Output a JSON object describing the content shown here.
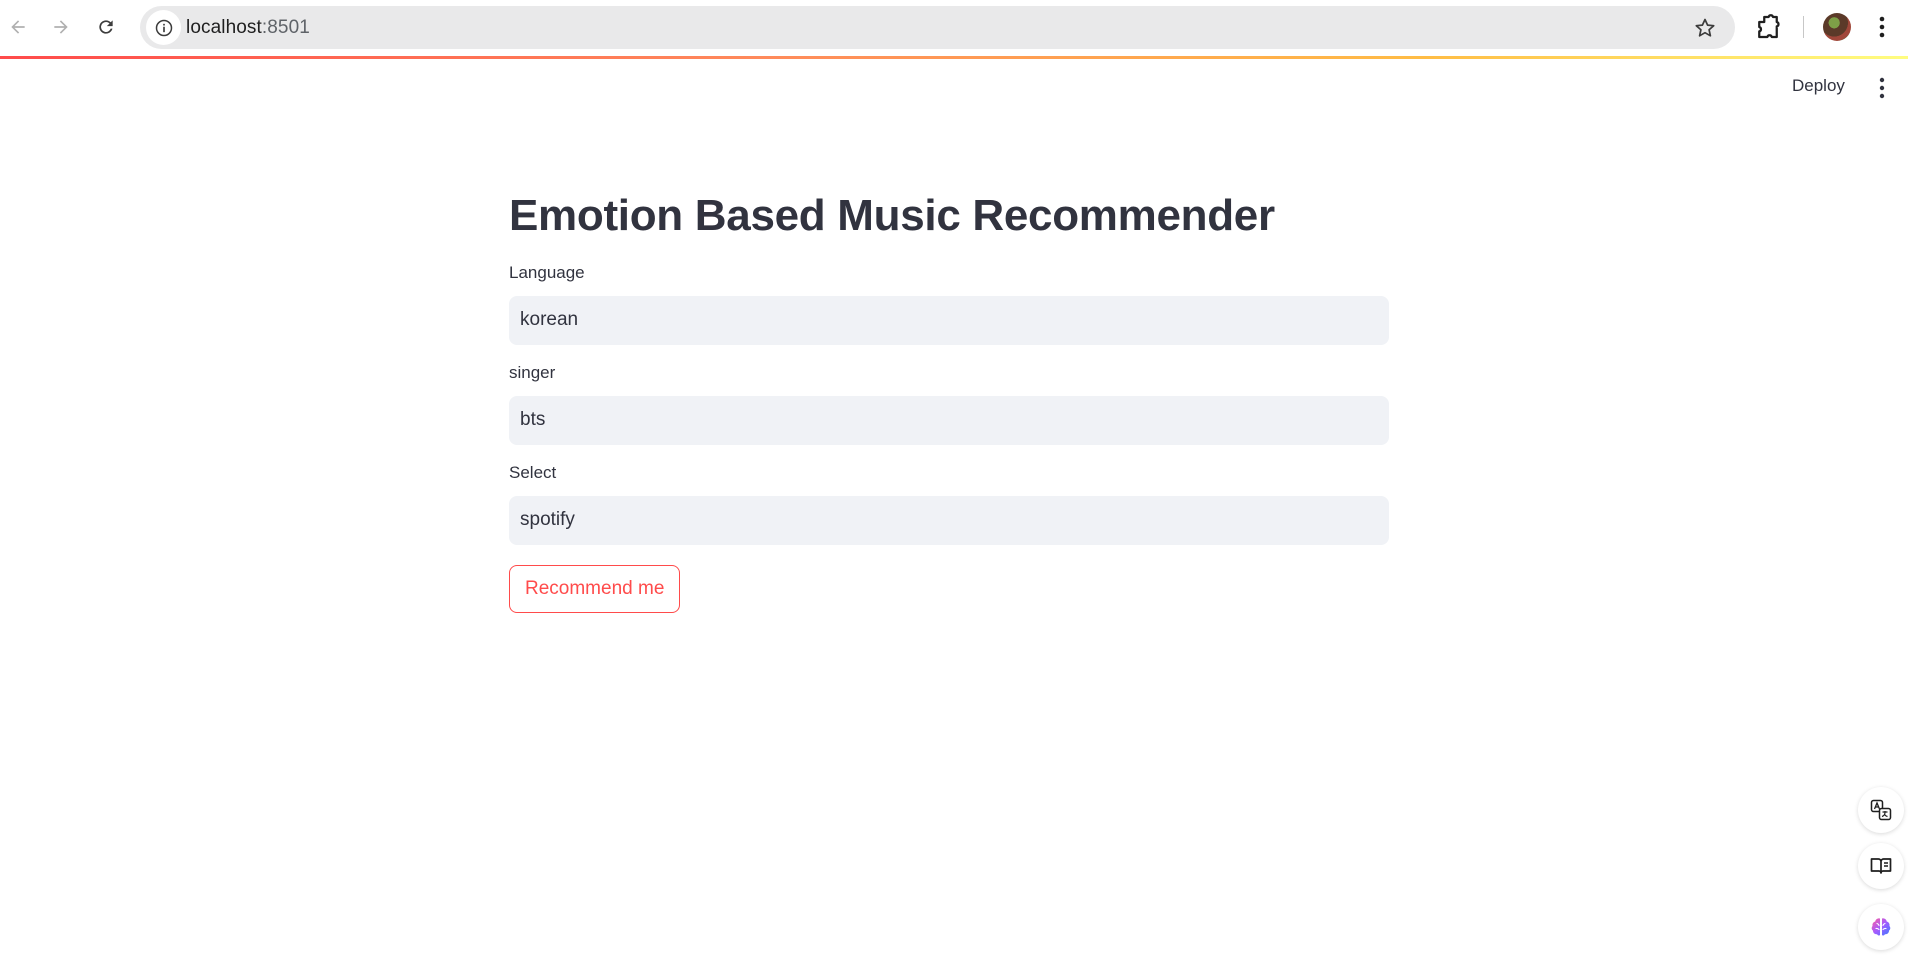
{
  "browser": {
    "url_host": "localhost",
    "url_port": ":8501",
    "icons": [
      "back-icon",
      "forward-icon",
      "reload-icon",
      "site-info-icon",
      "bookmark-star-icon",
      "extensions-icon",
      "profile-avatar",
      "chrome-menu-icon"
    ]
  },
  "header": {
    "deploy_label": "Deploy",
    "menu_icon": "more-vertical-icon"
  },
  "main": {
    "title": "Emotion Based Music Recommender",
    "fields": [
      {
        "label": "Language",
        "value": "korean"
      },
      {
        "label": "singer",
        "value": "bts"
      },
      {
        "label": "Select",
        "value": "spotify"
      }
    ],
    "button_label": "Recommend me"
  },
  "side_tools": {
    "icons": [
      "translate-icon",
      "reading-mode-icon",
      "ai-brain-icon"
    ]
  },
  "colors": {
    "accent": "#ff4b4b",
    "text": "#31333f",
    "input_bg": "#f0f2f6",
    "omnibox_bg": "#e9e9ea"
  }
}
